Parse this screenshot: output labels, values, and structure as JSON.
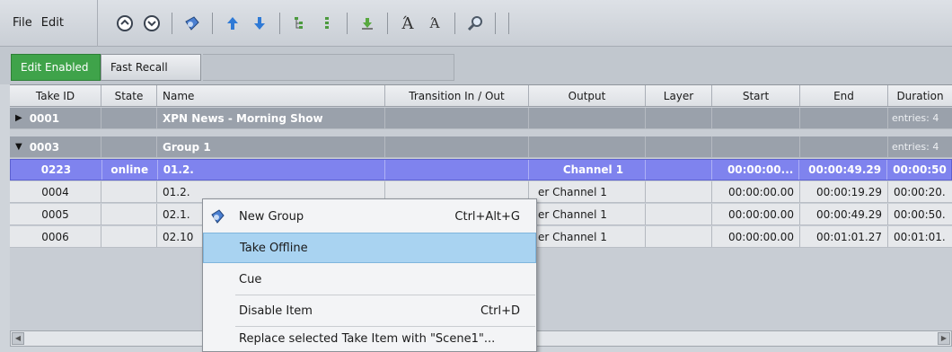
{
  "menu": {
    "file": "File",
    "edit": "Edit"
  },
  "toolbar": {
    "tools": [
      "circle-up-icon",
      "circle-down-icon",
      "take-icon",
      "arrow-up-icon",
      "arrow-down-icon",
      "tree-expand-icon",
      "tree-collapse-icon",
      "import-icon",
      "font-larger-icon",
      "font-smaller-icon",
      "search-icon"
    ]
  },
  "modes": {
    "edit_enabled": "Edit Enabled",
    "fast_recall": "Fast Recall",
    "edit_color": "#3fa34a"
  },
  "table": {
    "columns": [
      "Take ID",
      "State",
      "Name",
      "Transition In / Out",
      "Output",
      "Layer",
      "Start",
      "End",
      "Duration"
    ],
    "groups": [
      {
        "id": "0001",
        "name": "XPN News - Morning Show",
        "entries": "entries: 4",
        "expanded": false
      },
      {
        "id": "0003",
        "name": "Group 1",
        "entries": "entries: 4",
        "expanded": true
      }
    ],
    "selected_row": {
      "id": "0223",
      "state": "online",
      "name": "01.2.",
      "transition": "",
      "output": "Channel 1",
      "layer": "",
      "start": "00:00:00...",
      "end": "00:00:49.29",
      "duration": "00:00:50"
    },
    "rows": [
      {
        "id": "0004",
        "state": "",
        "name": "01.2.",
        "output": "er Channel 1",
        "start": "00:00:00.00",
        "end": "00:00:19.29",
        "duration": "00:00:20."
      },
      {
        "id": "0005",
        "state": "",
        "name": "02.1.",
        "output": "er Channel 1",
        "start": "00:00:00.00",
        "end": "00:00:49.29",
        "duration": "00:00:50."
      },
      {
        "id": "0006",
        "state": "",
        "name": "02.10",
        "output": "er Channel 1",
        "start": "00:00:00.00",
        "end": "00:01:01.27",
        "duration": "00:01:01."
      }
    ],
    "selection_color": "#7f83ee"
  },
  "context_menu": {
    "items": [
      {
        "label": "New Group",
        "shortcut": "Ctrl+Alt+G"
      },
      {
        "label": "Take Offline",
        "shortcut": "",
        "highlighted": true
      },
      {
        "label": "Cue",
        "shortcut": ""
      },
      {
        "label": "Disable Item",
        "shortcut": "Ctrl+D"
      },
      {
        "label": "Replace selected Take Item with \"Scene1\"...",
        "shortcut": ""
      }
    ]
  }
}
